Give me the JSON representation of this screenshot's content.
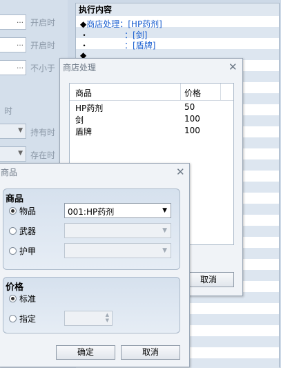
{
  "background": {
    "labels": [
      "开启时",
      "开启时",
      "不小于",
      "时",
      "持有时",
      "存在时"
    ]
  },
  "exec_panel": {
    "title": "执行内容",
    "lines": [
      {
        "bullet": "◆",
        "prefix": "",
        "text": "商店处理：[HP药剂]"
      },
      {
        "bullet": "・",
        "prefix": "",
        "text": "：[剑]"
      },
      {
        "bullet": "・",
        "prefix": "",
        "text": "：[盾牌]"
      },
      {
        "bullet": "◆",
        "prefix": "",
        "text": ""
      }
    ]
  },
  "shop_dialog": {
    "title": "商店处理",
    "columns": [
      "商品",
      "价格"
    ],
    "rows": [
      {
        "name": "HP药剂",
        "price": "50"
      },
      {
        "name": "剑",
        "price": "100"
      },
      {
        "name": "盾牌",
        "price": "100"
      }
    ],
    "cancel_label": "取消"
  },
  "product_dialog": {
    "title": "商品",
    "goods_group": {
      "title": "商品",
      "options": [
        {
          "label": "物品",
          "checked": true,
          "value": "001:HP药剂"
        },
        {
          "label": "武器",
          "checked": false,
          "value": ""
        },
        {
          "label": "护甲",
          "checked": false,
          "value": ""
        }
      ]
    },
    "price_group": {
      "title": "价格",
      "options": [
        {
          "label": "标准",
          "checked": true
        },
        {
          "label": "指定",
          "checked": false
        }
      ]
    },
    "ok_label": "确定",
    "cancel_label": "取消"
  },
  "icons": [
    "close-icon",
    "chevron-down-icon",
    "radio-icon",
    "spinner-icon"
  ]
}
